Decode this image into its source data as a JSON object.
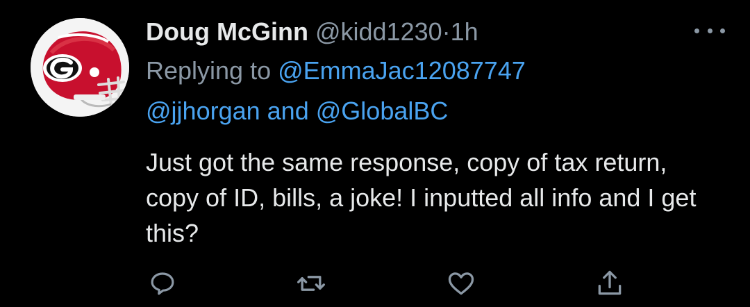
{
  "tweet": {
    "author": {
      "display_name": "Doug McGinn",
      "handle": "@kidd1230",
      "separator": "·",
      "time": "1h",
      "avatar_icon": "georgia-football-helmet-icon"
    },
    "replying": {
      "label": "Replying to",
      "mention_1": "@EmmaJac12087747",
      "mention_2": "@jjhorgan",
      "conjunction": "and",
      "mention_3": "@GlobalBC"
    },
    "text": "Just got the same response, copy of tax return, copy of ID, bills, a joke! I inputted all info and I get this?",
    "actions": [
      {
        "name": "reply",
        "icon": "comment-icon"
      },
      {
        "name": "retweet",
        "icon": "retweet-icon"
      },
      {
        "name": "like",
        "icon": "heart-icon"
      },
      {
        "name": "share",
        "icon": "share-icon"
      }
    ],
    "more_icon": "more-options-icon"
  },
  "colors": {
    "background": "#000000",
    "primary_text": "#e7e9ea",
    "secondary_text": "#8b98a5",
    "link": "#4aa3f0",
    "helmet_red": "#c8102e"
  }
}
